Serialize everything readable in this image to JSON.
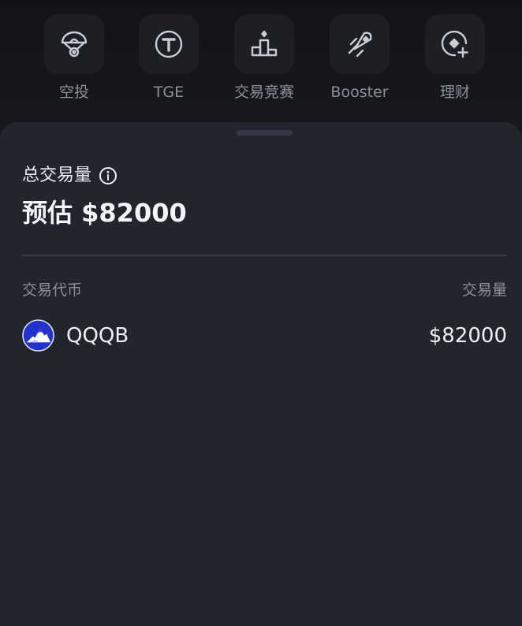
{
  "shortcuts": [
    {
      "label": "空投",
      "icon": "parachute-icon"
    },
    {
      "label": "TGE",
      "icon": "token-t-icon"
    },
    {
      "label": "交易竞赛",
      "icon": "podium-icon"
    },
    {
      "label": "Booster",
      "icon": "rocket-icon"
    },
    {
      "label": "理财",
      "icon": "earn-icon"
    }
  ],
  "sheet": {
    "volume_title": "总交易量",
    "estimate": "预估 $82000",
    "columns": {
      "token": "交易代币",
      "volume": "交易量"
    },
    "rows": [
      {
        "token": "QQQB",
        "volume": "$82000",
        "logo": "mountain-logo-icon"
      }
    ]
  },
  "colors": {
    "background": "#141519",
    "sheet": "#22252d",
    "muted_text": "#8a8f99",
    "primary_text": "#eef0f3",
    "token_logo": "#2233cc"
  }
}
